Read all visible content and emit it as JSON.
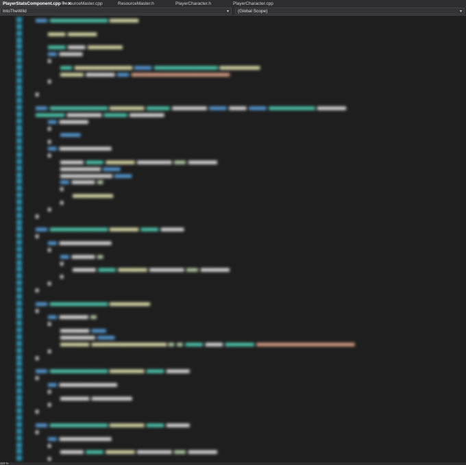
{
  "tabs": [
    {
      "label": "PlayerStatsComponent.cpp",
      "active": true
    },
    {
      "label": "ResourceMaster.cpp",
      "active": false
    },
    {
      "label": "ResourceMaster.h",
      "active": false
    },
    {
      "label": "PlayerCharacter.h",
      "active": false
    },
    {
      "label": "PlayerCharacter.cpp",
      "active": false
    }
  ],
  "navbar": {
    "project": "IntoTheWild",
    "scope": "(Global Scope)"
  },
  "status": {
    "zoom": "110 %"
  },
  "colors": {
    "background": "#1e1e1e",
    "line_number": "#2b91af",
    "keyword": "#569cd6",
    "type": "#4ec9b0",
    "function": "#dcdcaa",
    "string": "#d69d85",
    "number": "#b5cea8",
    "text": "#dcdcdc"
  }
}
